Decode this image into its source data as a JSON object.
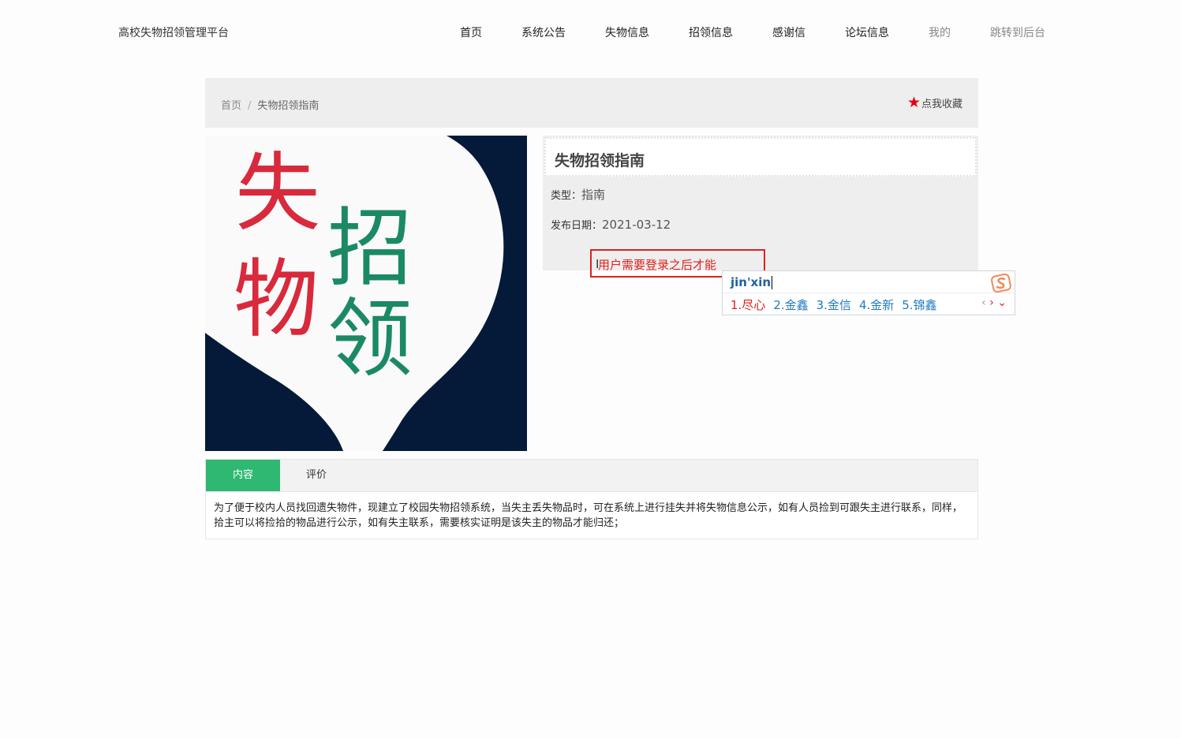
{
  "header": {
    "site_title": "高校失物招领管理平台",
    "nav": [
      "首页",
      "系统公告",
      "失物信息",
      "招领信息",
      "感谢信",
      "论坛信息",
      "我的",
      "跳转到后台"
    ]
  },
  "breadcrumb": {
    "home": "首页",
    "separator": "/",
    "current": "失物招领指南",
    "favorite_label": "点我收藏"
  },
  "poster": {
    "line1": "失物",
    "line2": "招领",
    "char1": "失",
    "char2": "物",
    "char3": "招",
    "char4": "领",
    "red": "#d82a3c",
    "green": "#1b8a63",
    "bg": "#051a38"
  },
  "detail": {
    "title": "失物招领指南",
    "type_label": "类型：",
    "type_value": "指南",
    "date_label": "发布日期：",
    "date_value": "2021-03-12",
    "login_notice": "用户需要登录之后才能"
  },
  "ime": {
    "input": "jin'xin",
    "candidates": [
      "1.尽心",
      "2.金鑫",
      "3.金信",
      "4.金新",
      "5.锦鑫"
    ],
    "prev_icon": "chevron-left-icon",
    "next_icon": "chevron-right-icon",
    "expand_icon": "chevron-down-icon"
  },
  "tabs": {
    "items": [
      "内容",
      "评价"
    ],
    "active": 0,
    "content": "为了便于校内人员找回遗失物件，现建立了校园失物招领系统，当失主丢失物品时，可在系统上进行挂失并将失物信息公示，如有人员捡到可跟失主进行联系，同样，拾主可以将捡拾的物品进行公示，如有失主联系，需要核实证明是该失主的物品才能归还；"
  }
}
